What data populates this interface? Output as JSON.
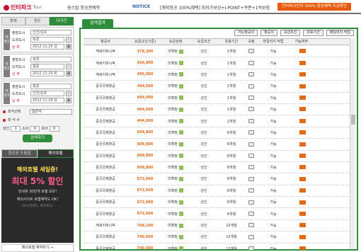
{
  "header": {
    "logo": "인터파크",
    "logo_tour": "Tour",
    "subtitle": "원스탑 항공권예약",
    "notice_label": "NOTICE",
    "notice_text": "[해외항공 100%혜택] 최저가보상+I-POINT+쿠폰+1억보험",
    "promo": "인터파크만의 100% 항공혜택 지금확인"
  },
  "sidebar": {
    "tabs": [
      "왕복",
      "편도",
      "다구간"
    ],
    "legs": [
      {
        "label": "여정1",
        "depart": "인천/김포",
        "arrive": "북경",
        "date": "2012.11.16 금"
      },
      {
        "label": "여정2",
        "depart": "북경",
        "arrive": "홍콩",
        "date": "2012.11.20 화"
      },
      {
        "label": "여정3",
        "depart": "홍콩",
        "arrive": "인천/김포",
        "date": "2012.11.28 목"
      }
    ],
    "field_labels": {
      "depart": "출발도시",
      "arrive": "도착도시",
      "date": "날 짜"
    },
    "seat_label": "좌석선택",
    "seat_value": "일반석",
    "count_label": "좌 석 수",
    "count": {
      "adult_label": "성인",
      "adult": "1",
      "child_label": "소아",
      "child": "0",
      "infant_label": "유아",
      "infant": "0"
    },
    "search_button": "검색하기",
    "bottom_tabs": [
      "항공권 도움말",
      "해외호텔"
    ],
    "ad": {
      "line1": "해외호텔 세일중!",
      "line2": "최대 5% 할인",
      "line3": "전세계 30만개 호텔 보유!",
      "line4": "해외사이트 호텔예약도 OK!",
      "line5": "(마스터카드, 비자카드)",
      "foot": "해외호텔 예약하기 →"
    }
  },
  "main": {
    "tab": "검색결과",
    "filters": [
      "가는항공사",
      "항공사",
      "요금조건",
      "유효기간",
      "매일리지 적립"
    ],
    "columns": [
      "항공사",
      "요금(1인기준)",
      "요금상태",
      "요금조건",
      "유효기간",
      "규정",
      "마일리지 적립",
      "가능여부"
    ],
    "rows": [
      {
        "airline": "케세이퍼시픽",
        "fare": "378,300",
        "status": "미확정",
        "cond": "성인",
        "valid": "1개월",
        "mile": "가능"
      },
      {
        "airline": "케세이퍼시픽",
        "fare": "426,800",
        "status": "미확정",
        "cond": "성인",
        "valid": "1개월",
        "mile": "가능"
      },
      {
        "airline": "케세이퍼시픽",
        "fare": "485,000",
        "status": "미확정",
        "cond": "성인",
        "valid": "1개월",
        "mile": "가능"
      },
      {
        "airline": "중국국제항공",
        "fare": "494,000",
        "status": "미확정",
        "cond": "성인",
        "valid": "1개월",
        "mile": "가능"
      },
      {
        "airline": "중국국제항공",
        "fare": "494,000",
        "status": "미확정",
        "cond": "성인",
        "valid": "1개월",
        "mile": "가능"
      },
      {
        "airline": "중국국제항공",
        "fare": "494,000",
        "status": "미확정",
        "cond": "성인",
        "valid": "1개월",
        "mile": "가능"
      },
      {
        "airline": "중국국제항공",
        "fare": "494,000",
        "status": "미확정",
        "cond": "성인",
        "valid": "1개월",
        "mile": "가능"
      },
      {
        "airline": "중국국제항공",
        "fare": "609,800",
        "status": "미확정",
        "cond": "성인",
        "valid": "6개월",
        "mile": "가능"
      },
      {
        "airline": "중국국제항공",
        "fare": "609,800",
        "status": "미확정",
        "cond": "성인",
        "valid": "6개월",
        "mile": "가능"
      },
      {
        "airline": "중국국제항공",
        "fare": "609,800",
        "status": "미확정",
        "cond": "성인",
        "valid": "6개월",
        "mile": "가능"
      },
      {
        "airline": "중국국제항공",
        "fare": "609,800",
        "status": "미확정",
        "cond": "성인",
        "valid": "6개월",
        "mile": "가능"
      },
      {
        "airline": "중국국제항공",
        "fare": "672,600",
        "status": "미확정",
        "cond": "성인",
        "valid": "6개월",
        "mile": "가능"
      },
      {
        "airline": "중국국제항공",
        "fare": "672,600",
        "status": "미확정",
        "cond": "성인",
        "valid": "6개월",
        "mile": "가능"
      },
      {
        "airline": "중국국제항공",
        "fare": "672,600",
        "status": "미확정",
        "cond": "성인",
        "valid": "6개월",
        "mile": "가능"
      },
      {
        "airline": "중국국제항공",
        "fare": "672,600",
        "status": "미확정",
        "cond": "성인",
        "valid": "6개월",
        "mile": "가능"
      },
      {
        "airline": "케세이퍼시픽",
        "fare": "708,100",
        "status": "미확정",
        "cond": "성인",
        "valid": "12개월",
        "mile": "가능"
      },
      {
        "airline": "중국국제항공",
        "fare": "740,600",
        "status": "미확정",
        "cond": "성인",
        "valid": "12개월",
        "mile": "가능"
      },
      {
        "airline": "중국국제항공",
        "fare": "740,600",
        "status": "미확정",
        "cond": "성인",
        "valid": "12개월",
        "mile": "가능"
      }
    ]
  },
  "colors": {
    "brand_green": "#2f8c3a",
    "fare_orange": "#e06a16",
    "logo_red": "#c8102e"
  }
}
